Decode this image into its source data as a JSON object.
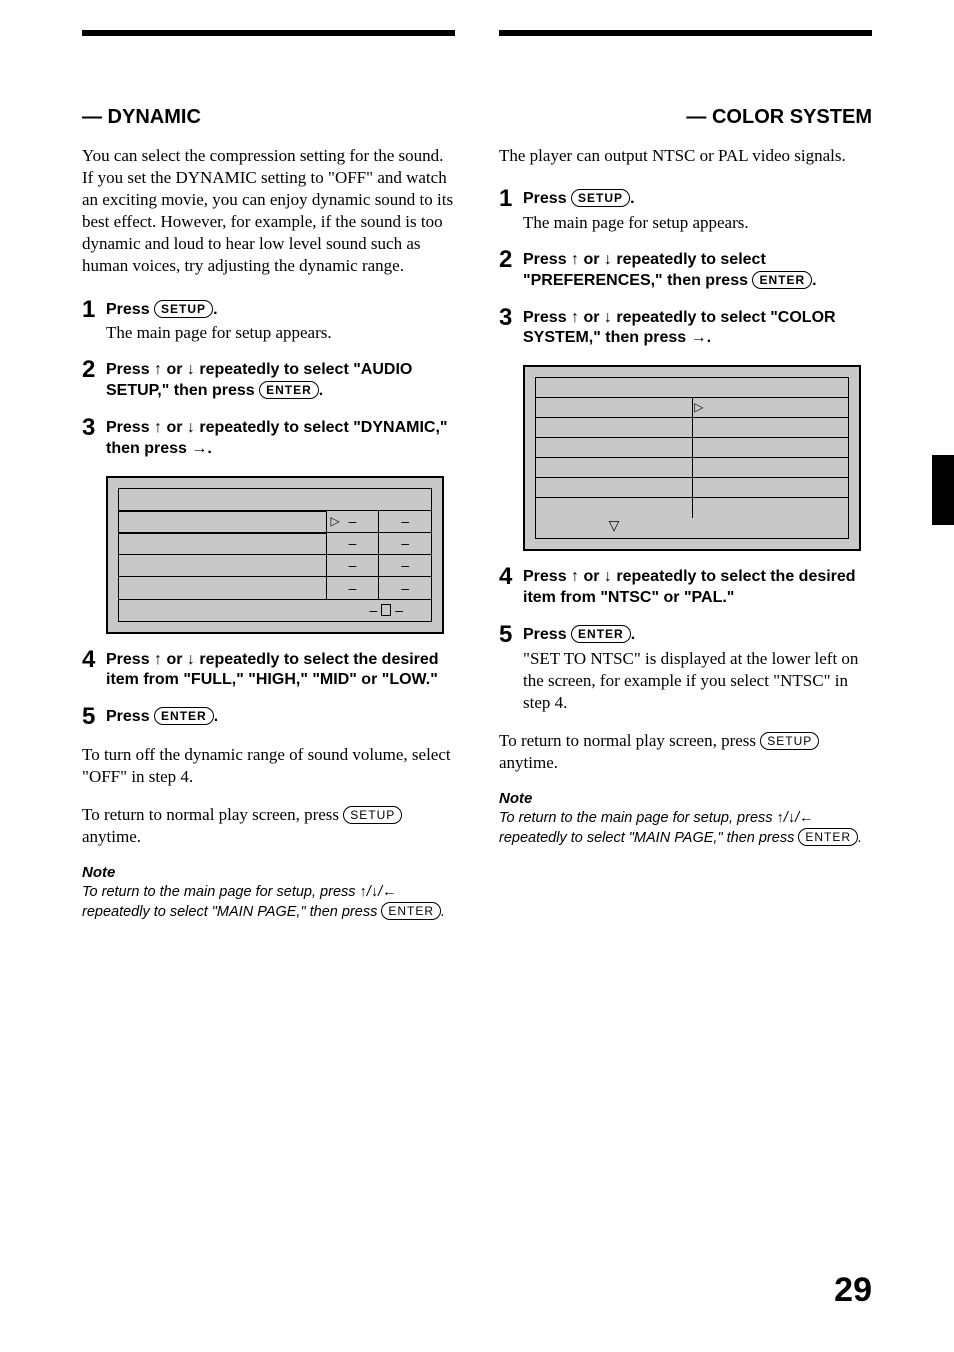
{
  "pageNumber": "29",
  "buttons": {
    "setup": "SETUP",
    "enter": "ENTER"
  },
  "left": {
    "heading": "— DYNAMIC",
    "intro": "You can select the compression setting for the sound. If you set the DYNAMIC setting to \"OFF\" and watch an exciting movie, you can enjoy dynamic sound to its best effect. However, for example, if the sound is too dynamic and loud to hear low level sound such as human voices, try adjusting the dynamic range.",
    "steps": {
      "s1": {
        "head_a": "Press ",
        "head_b": ".",
        "body": "The main page for setup appears."
      },
      "s2": {
        "head": "Press ↑ or ↓ repeatedly to select \"AUDIO SETUP,\" then press ",
        "head_b": "."
      },
      "s3": {
        "head": "Press ↑ or ↓ repeatedly to select \"DYNAMIC,\" then press →."
      },
      "s4": {
        "head": "Press ↑ or ↓ repeatedly to select the desired item from \"FULL,\" \"HIGH,\" \"MID\" or \"LOW.\""
      },
      "s5": {
        "head_a": "Press ",
        "head_b": "."
      }
    },
    "para1": "To turn off the dynamic range of sound volume, select \"OFF\" in step 4.",
    "para2_a": "To return to normal play screen, press ",
    "para2_b": " anytime.",
    "noteHead": "Note",
    "note_a": "To return to the main page for setup, press ↑/↓/← repeatedly to select \"MAIN PAGE,\" then press ",
    "note_b": "."
  },
  "right": {
    "heading": "— COLOR SYSTEM",
    "intro": "The player can output NTSC or PAL video signals.",
    "steps": {
      "s1": {
        "head_a": "Press ",
        "head_b": ".",
        "body": "The main page for setup appears."
      },
      "s2": {
        "head": "Press ↑ or ↓ repeatedly to select \"PREFERENCES,\" then press ",
        "head_b": "."
      },
      "s3": {
        "head": "Press ↑ or ↓ repeatedly to select \"COLOR SYSTEM,\" then press →."
      },
      "s4": {
        "head": "Press ↑ or ↓ repeatedly to select the desired item from \"NTSC\" or \"PAL.\""
      },
      "s5": {
        "head_a": "Press ",
        "head_b": ".",
        "body": "\"SET TO NTSC\" is displayed at the lower left on the screen, for example if you select \"NTSC\" in step 4."
      }
    },
    "para2_a": "To return to normal play screen, press ",
    "para2_b": " anytime.",
    "noteHead": "Note",
    "note_a": "To return to the main page for setup, press ↑/↓/← repeatedly to select \"MAIN PAGE,\" then press ",
    "note_b": "."
  }
}
